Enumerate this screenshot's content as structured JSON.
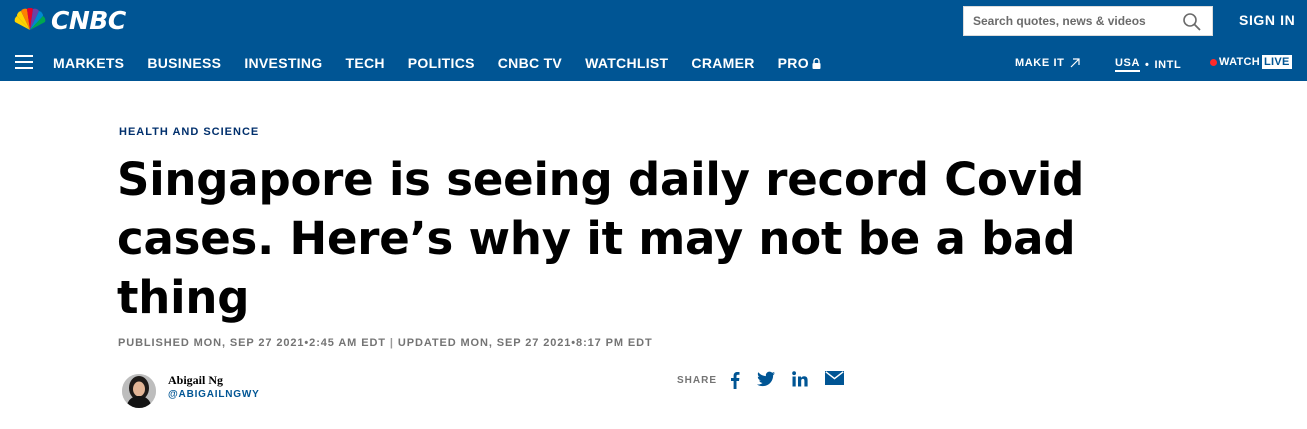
{
  "header": {
    "logo_text": "CNBC",
    "search": {
      "placeholder": "Search quotes, news & videos"
    },
    "signin_label": "SIGN IN",
    "nav": [
      {
        "label": "MARKETS"
      },
      {
        "label": "BUSINESS"
      },
      {
        "label": "INVESTING"
      },
      {
        "label": "TECH"
      },
      {
        "label": "POLITICS"
      },
      {
        "label": "CNBC TV"
      },
      {
        "label": "WATCHLIST"
      },
      {
        "label": "CRAMER"
      },
      {
        "label": "PRO",
        "icon": "lock-icon"
      }
    ],
    "make_it_label": "MAKE IT",
    "edition": {
      "usa": "USA",
      "separator": "•",
      "intl": "INTL"
    },
    "watch_label": "WATCH",
    "live_label": "LIVE"
  },
  "article": {
    "eyebrow": "HEALTH AND SCIENCE",
    "headline": "Singapore is seeing daily record Covid cases. Here’s why it may not be a bad thing",
    "published": "PUBLISHED MON, SEP 27 2021•2:45 AM EDT",
    "separator": "|",
    "updated": "UPDATED MON, SEP 27 2021•8:17 PM EDT",
    "author": {
      "name": "Abigail Ng",
      "handle": "@ABIGAILNGWY"
    },
    "share_label": "SHARE",
    "share_icons": [
      "facebook-icon",
      "twitter-icon",
      "linkedin-icon",
      "email-icon"
    ]
  },
  "colors": {
    "brand_blue": "#005594",
    "eyebrow_navy": "#002f6c",
    "live_red": "#ff2a2a",
    "meta_gray": "#747474"
  }
}
